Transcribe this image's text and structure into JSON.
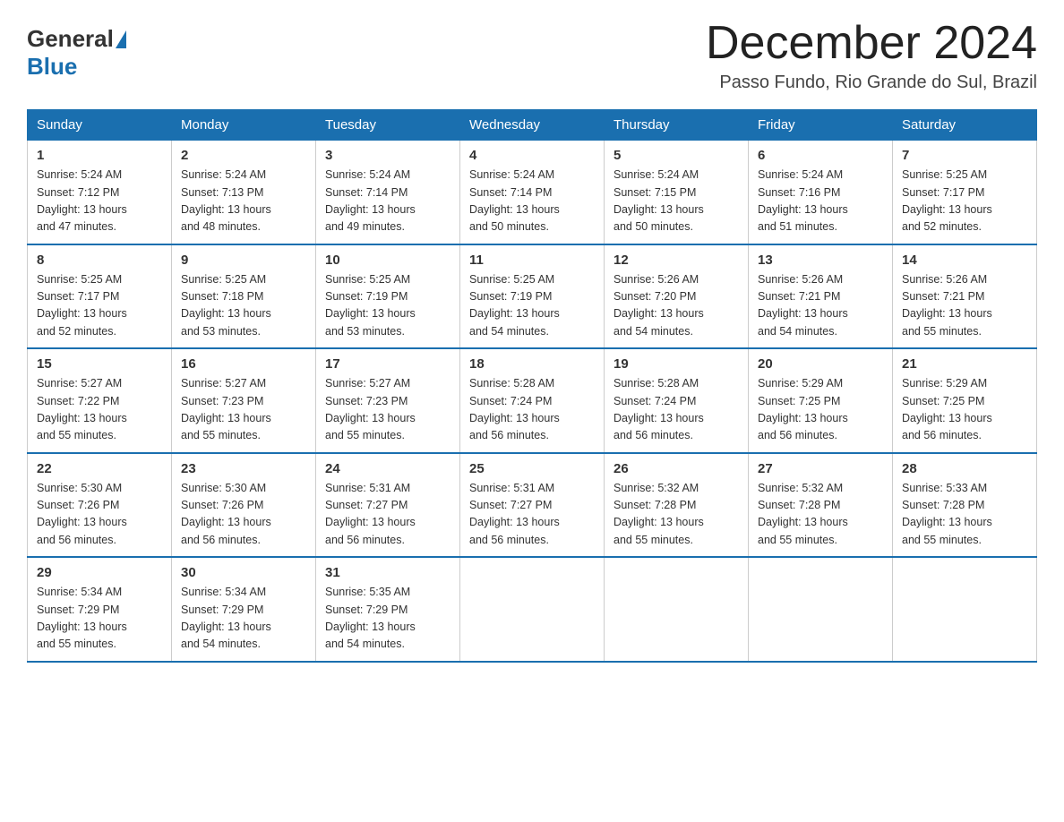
{
  "header": {
    "logo_general": "General",
    "logo_blue": "Blue",
    "month_year": "December 2024",
    "location": "Passo Fundo, Rio Grande do Sul, Brazil"
  },
  "days_of_week": [
    "Sunday",
    "Monday",
    "Tuesday",
    "Wednesday",
    "Thursday",
    "Friday",
    "Saturday"
  ],
  "weeks": [
    [
      {
        "day": "1",
        "sunrise": "5:24 AM",
        "sunset": "7:12 PM",
        "daylight": "13 hours and 47 minutes."
      },
      {
        "day": "2",
        "sunrise": "5:24 AM",
        "sunset": "7:13 PM",
        "daylight": "13 hours and 48 minutes."
      },
      {
        "day": "3",
        "sunrise": "5:24 AM",
        "sunset": "7:14 PM",
        "daylight": "13 hours and 49 minutes."
      },
      {
        "day": "4",
        "sunrise": "5:24 AM",
        "sunset": "7:14 PM",
        "daylight": "13 hours and 50 minutes."
      },
      {
        "day": "5",
        "sunrise": "5:24 AM",
        "sunset": "7:15 PM",
        "daylight": "13 hours and 50 minutes."
      },
      {
        "day": "6",
        "sunrise": "5:24 AM",
        "sunset": "7:16 PM",
        "daylight": "13 hours and 51 minutes."
      },
      {
        "day": "7",
        "sunrise": "5:25 AM",
        "sunset": "7:17 PM",
        "daylight": "13 hours and 52 minutes."
      }
    ],
    [
      {
        "day": "8",
        "sunrise": "5:25 AM",
        "sunset": "7:17 PM",
        "daylight": "13 hours and 52 minutes."
      },
      {
        "day": "9",
        "sunrise": "5:25 AM",
        "sunset": "7:18 PM",
        "daylight": "13 hours and 53 minutes."
      },
      {
        "day": "10",
        "sunrise": "5:25 AM",
        "sunset": "7:19 PM",
        "daylight": "13 hours and 53 minutes."
      },
      {
        "day": "11",
        "sunrise": "5:25 AM",
        "sunset": "7:19 PM",
        "daylight": "13 hours and 54 minutes."
      },
      {
        "day": "12",
        "sunrise": "5:26 AM",
        "sunset": "7:20 PM",
        "daylight": "13 hours and 54 minutes."
      },
      {
        "day": "13",
        "sunrise": "5:26 AM",
        "sunset": "7:21 PM",
        "daylight": "13 hours and 54 minutes."
      },
      {
        "day": "14",
        "sunrise": "5:26 AM",
        "sunset": "7:21 PM",
        "daylight": "13 hours and 55 minutes."
      }
    ],
    [
      {
        "day": "15",
        "sunrise": "5:27 AM",
        "sunset": "7:22 PM",
        "daylight": "13 hours and 55 minutes."
      },
      {
        "day": "16",
        "sunrise": "5:27 AM",
        "sunset": "7:23 PM",
        "daylight": "13 hours and 55 minutes."
      },
      {
        "day": "17",
        "sunrise": "5:27 AM",
        "sunset": "7:23 PM",
        "daylight": "13 hours and 55 minutes."
      },
      {
        "day": "18",
        "sunrise": "5:28 AM",
        "sunset": "7:24 PM",
        "daylight": "13 hours and 56 minutes."
      },
      {
        "day": "19",
        "sunrise": "5:28 AM",
        "sunset": "7:24 PM",
        "daylight": "13 hours and 56 minutes."
      },
      {
        "day": "20",
        "sunrise": "5:29 AM",
        "sunset": "7:25 PM",
        "daylight": "13 hours and 56 minutes."
      },
      {
        "day": "21",
        "sunrise": "5:29 AM",
        "sunset": "7:25 PM",
        "daylight": "13 hours and 56 minutes."
      }
    ],
    [
      {
        "day": "22",
        "sunrise": "5:30 AM",
        "sunset": "7:26 PM",
        "daylight": "13 hours and 56 minutes."
      },
      {
        "day": "23",
        "sunrise": "5:30 AM",
        "sunset": "7:26 PM",
        "daylight": "13 hours and 56 minutes."
      },
      {
        "day": "24",
        "sunrise": "5:31 AM",
        "sunset": "7:27 PM",
        "daylight": "13 hours and 56 minutes."
      },
      {
        "day": "25",
        "sunrise": "5:31 AM",
        "sunset": "7:27 PM",
        "daylight": "13 hours and 56 minutes."
      },
      {
        "day": "26",
        "sunrise": "5:32 AM",
        "sunset": "7:28 PM",
        "daylight": "13 hours and 55 minutes."
      },
      {
        "day": "27",
        "sunrise": "5:32 AM",
        "sunset": "7:28 PM",
        "daylight": "13 hours and 55 minutes."
      },
      {
        "day": "28",
        "sunrise": "5:33 AM",
        "sunset": "7:28 PM",
        "daylight": "13 hours and 55 minutes."
      }
    ],
    [
      {
        "day": "29",
        "sunrise": "5:34 AM",
        "sunset": "7:29 PM",
        "daylight": "13 hours and 55 minutes."
      },
      {
        "day": "30",
        "sunrise": "5:34 AM",
        "sunset": "7:29 PM",
        "daylight": "13 hours and 54 minutes."
      },
      {
        "day": "31",
        "sunrise": "5:35 AM",
        "sunset": "7:29 PM",
        "daylight": "13 hours and 54 minutes."
      },
      null,
      null,
      null,
      null
    ]
  ],
  "labels": {
    "sunrise": "Sunrise:",
    "sunset": "Sunset:",
    "daylight": "Daylight:"
  }
}
